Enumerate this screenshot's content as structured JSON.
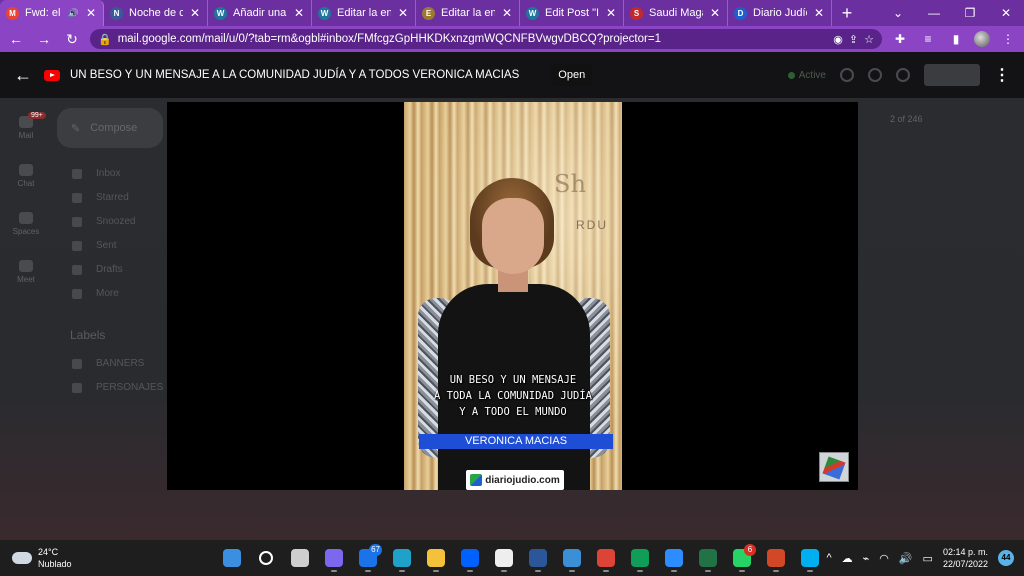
{
  "tabs": [
    {
      "title": "Fwd: el m",
      "fav_color": "#ea4335",
      "fav_glyph": "M",
      "active": true
    },
    {
      "title": "Noche de cele",
      "fav_color": "#3b5998",
      "fav_glyph": "N",
      "active": false
    },
    {
      "title": "Añadir una n",
      "fav_color": "#21759b",
      "fav_glyph": "W",
      "active": false
    },
    {
      "title": "Editar la entra",
      "fav_color": "#21759b",
      "fav_glyph": "W",
      "active": false
    },
    {
      "title": "Editar la entra",
      "fav_color": "#9c7a2c",
      "fav_glyph": "E",
      "active": false
    },
    {
      "title": "Edit Post \"It a",
      "fav_color": "#21759b",
      "fav_glyph": "W",
      "active": false
    },
    {
      "title": "Saudi Magazi",
      "fav_color": "#c62828",
      "fav_glyph": "S",
      "active": false
    },
    {
      "title": "Diario Judío: N",
      "fav_color": "#1e5fd0",
      "fav_glyph": "D",
      "active": false
    }
  ],
  "address": {
    "url": "mail.google.com/mail/u/0/?tab=rm&ogbl#inbox/FMfcgzGpHHKDKxnzgmWQCNFBVwgvDBCQ?projector=1"
  },
  "gmail": {
    "rail": [
      "Mail",
      "Chat",
      "Spaces",
      "Meet"
    ],
    "mail_badge": "99+",
    "compose": "Compose",
    "nav": [
      "Inbox",
      "Starred",
      "Snoozed",
      "Sent",
      "Drafts",
      "More"
    ],
    "labels_heading": "Labels",
    "labels": [
      "BANNERS",
      "PERSONAJES"
    ],
    "counter": "2 of 246",
    "status": "Active"
  },
  "media": {
    "title": "UN BESO Y UN MENSAJE A LA COMUNIDAD JUDÍA Y A TODOS VERONICA MACIAS",
    "open_label": "Open"
  },
  "video": {
    "caption_lines": [
      "UN BESO Y UN MENSAJE",
      "A TODA LA COMUNIDAD JUDÍA",
      "Y A TODO EL MUNDO"
    ],
    "name": "VERONICA MACIAS",
    "brand": "diariojudio.com"
  },
  "taskbar": {
    "temp": "24°C",
    "condition": "Nublado",
    "time": "02:14 p. m.",
    "date": "22/07/2022",
    "notif_count": "44",
    "apps": [
      {
        "name": "start-icon",
        "color": "#3b8fe0",
        "badge": ""
      },
      {
        "name": "search-icon",
        "color": "#1f1e1e",
        "badge": ""
      },
      {
        "name": "task-view-icon",
        "color": "#cfcfcf",
        "badge": ""
      },
      {
        "name": "teams-chat-icon",
        "color": "#7b68ee",
        "badge": ""
      },
      {
        "name": "mail-icon",
        "color": "#1a73e8",
        "badge": "67"
      },
      {
        "name": "edge-icon",
        "color": "#1fa2c9",
        "badge": ""
      },
      {
        "name": "file-explorer-icon",
        "color": "#f3c13a",
        "badge": ""
      },
      {
        "name": "dropbox-icon",
        "color": "#0061fe",
        "badge": ""
      },
      {
        "name": "capcut-icon",
        "color": "#eeeeee",
        "badge": ""
      },
      {
        "name": "word-icon",
        "color": "#2b579a",
        "badge": ""
      },
      {
        "name": "photos-icon",
        "color": "#3a8fd6",
        "badge": ""
      },
      {
        "name": "chrome-icon",
        "color": "#db4437",
        "badge": ""
      },
      {
        "name": "chrome-profile-icon",
        "color": "#0f9d58",
        "badge": ""
      },
      {
        "name": "zoom-icon",
        "color": "#2d8cff",
        "badge": ""
      },
      {
        "name": "excel-icon",
        "color": "#217346",
        "badge": ""
      },
      {
        "name": "whatsapp-icon",
        "color": "#25d366",
        "badge": "6"
      },
      {
        "name": "powerpoint-icon",
        "color": "#d24726",
        "badge": ""
      },
      {
        "name": "skype-icon",
        "color": "#00aff0",
        "badge": ""
      }
    ]
  }
}
